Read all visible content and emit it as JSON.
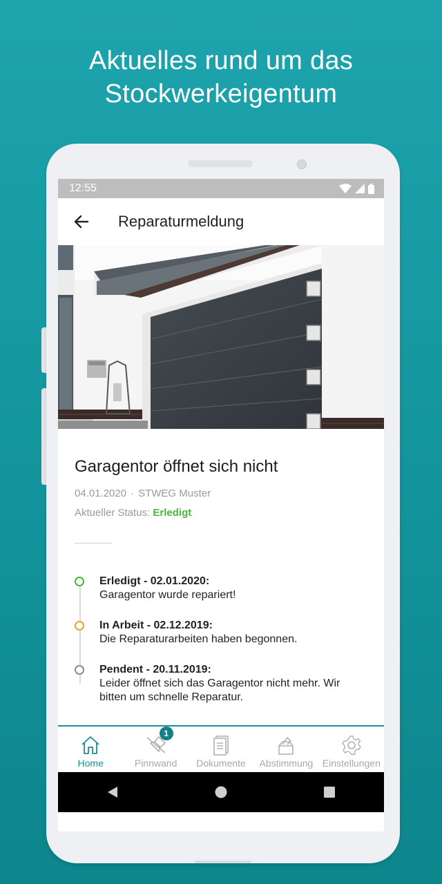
{
  "headline": {
    "line1": "Aktuelles rund um das",
    "line2": "Stockwerkeigentum"
  },
  "statusbar": {
    "time": "12:55"
  },
  "appbar": {
    "title": "Reparaturmeldung"
  },
  "report": {
    "title": "Garagentor öffnet sich nicht",
    "date": "04.01.2020",
    "separator": "·",
    "property": "STWEG Muster",
    "status_label": "Aktueller Status:",
    "status_value": "Erledigt"
  },
  "timeline": [
    {
      "heading": "Erledigt - 02.01.2020:",
      "text": "Garagentor wurde repariert!",
      "color": "#4bb53c"
    },
    {
      "heading": "In Arbeit - 02.12.2019:",
      "text": "Die Reparaturarbeiten haben begonnen.",
      "color": "#e2a52a"
    },
    {
      "heading": "Pendent - 20.11.2019:",
      "text": "Leider öffnet sich das Garagentor nicht mehr. Wir bitten um schnelle Reparatur.",
      "color": "#8a8a8a"
    }
  ],
  "tabs": [
    {
      "label": "Home",
      "icon": "home-icon",
      "active": true
    },
    {
      "label": "Pinnwand",
      "icon": "pin-icon",
      "badge": "1"
    },
    {
      "label": "Dokumente",
      "icon": "document-icon"
    },
    {
      "label": "Abstimmung",
      "icon": "ballot-icon"
    },
    {
      "label": "Einstellungen",
      "icon": "gear-icon"
    }
  ],
  "colors": {
    "accent": "#1a8f96",
    "done": "#4bb53c",
    "in_progress": "#e2a52a",
    "pending": "#8a8a8a"
  }
}
